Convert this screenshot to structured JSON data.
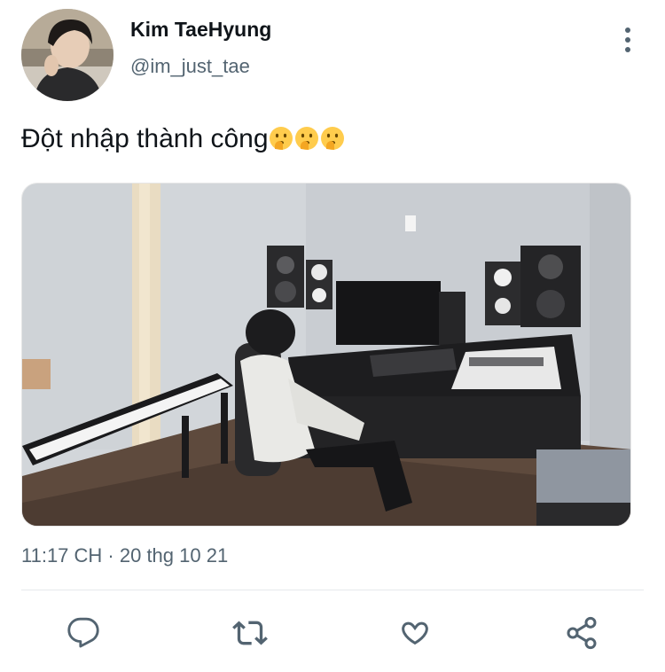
{
  "user": {
    "name": "Kim TaeHyung",
    "handle": "@im_just_tae"
  },
  "tweet": {
    "text": "Đột nhập thành công",
    "emojis": [
      "shushing-face",
      "shushing-face",
      "shushing-face"
    ],
    "media_icon": "music-studio-photo",
    "timestamp": "11:17 CH · 20 thg 10 21"
  },
  "actions": [
    {
      "icon": "reply-icon"
    },
    {
      "icon": "retweet-icon"
    },
    {
      "icon": "like-icon"
    },
    {
      "icon": "share-icon"
    }
  ],
  "colors": {
    "text": "#0f1419",
    "secondary": "#536471",
    "divider": "#e6e9ec"
  }
}
